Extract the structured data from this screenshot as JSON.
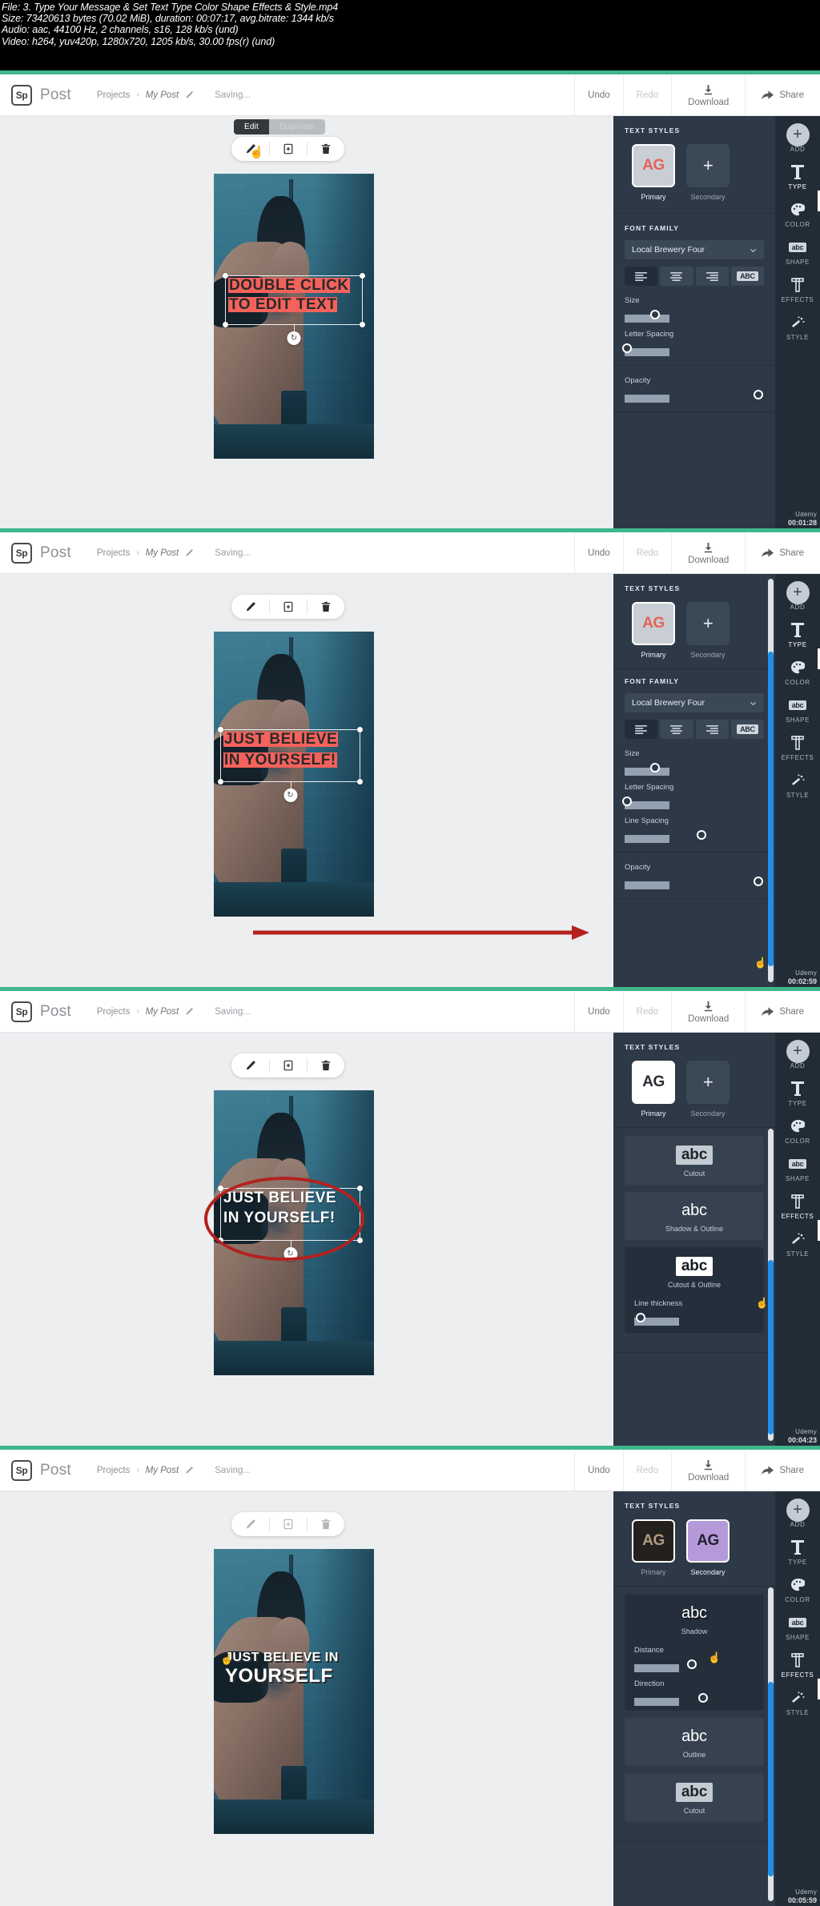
{
  "fileinfo": {
    "line1": "File: 3. Type Your Message & Set Text Type  Color  Shape  Effects & Style.mp4",
    "line2": "Size: 73420613 bytes (70.02 MiB), duration: 00:07:17, avg.bitrate: 1344 kb/s",
    "line3": "Audio: aac, 44100 Hz, 2 channels, s16, 128 kb/s (und)",
    "line4": "Video: h264, yuv420p, 1280x720, 1205 kb/s, 30.00 fps(r) (und)"
  },
  "appbar": {
    "logo": "Sp",
    "product": "Post",
    "crumb_root": "Projects",
    "crumb_sep": "›",
    "crumb_current": "My Post",
    "status": "Saving...",
    "undo": "Undo",
    "redo": "Redo",
    "download": "Download",
    "share": "Share"
  },
  "objtoolbar": {
    "tooltip_edit": "Edit",
    "tooltip_duplicate": "Duplicate"
  },
  "rail": {
    "items": [
      {
        "label": "ADD",
        "icon": "plus-circle-icon"
      },
      {
        "label": "TYPE",
        "icon": "type-t-icon"
      },
      {
        "label": "COLOR",
        "icon": "palette-icon"
      },
      {
        "label": "SHAPE",
        "icon": "abc-shape-icon"
      },
      {
        "label": "EFFECTS",
        "icon": "effects-t-icon"
      },
      {
        "label": "STYLE",
        "icon": "magic-wand-icon"
      }
    ]
  },
  "panels": [
    {
      "id": "panel-1",
      "timestamp": "00:01:28",
      "watermark": "Udemy",
      "canvas_text": [
        "DOUBLE CLICK",
        "TO EDIT TEXT"
      ],
      "canvas_text_style": "highlight",
      "active_rail": "TYPE",
      "sidebar": {
        "text_styles_title": "TEXT STYLES",
        "primary_label": "Primary",
        "secondary_label": "Secondary",
        "primary_glyph": "AG",
        "secondary_glyph": "+",
        "font_family_title": "FONT FAMILY",
        "font_family_value": "Local Brewery Four",
        "sliders": [
          {
            "label": "Size",
            "value": 22
          },
          {
            "label": "Letter Spacing",
            "value": 2
          },
          {
            "label": "Opacity",
            "value": 96
          }
        ]
      }
    },
    {
      "id": "panel-2",
      "timestamp": "00:02:59",
      "watermark": "Udemy",
      "canvas_text": [
        "JUST BELIEVE",
        "IN YOURSELF!"
      ],
      "canvas_text_style": "highlight",
      "active_rail": "TYPE",
      "sidebar": {
        "text_styles_title": "TEXT STYLES",
        "primary_label": "Primary",
        "secondary_label": "Secondary",
        "primary_glyph": "AG",
        "secondary_glyph": "+",
        "font_family_title": "FONT FAMILY",
        "font_family_value": "Local Brewery Four",
        "sliders": [
          {
            "label": "Size",
            "value": 22
          },
          {
            "label": "Letter Spacing",
            "value": 2
          },
          {
            "label": "Line Spacing",
            "value": 55
          },
          {
            "label": "Opacity",
            "value": 96
          }
        ]
      },
      "annotation": "red-arrow-to-opacity-slider"
    },
    {
      "id": "panel-3",
      "timestamp": "00:04:23",
      "watermark": "Udemy",
      "canvas_text": [
        "JUST BELIEVE",
        "IN YOURSELF!"
      ],
      "canvas_text_style": "cutout",
      "active_rail": "EFFECTS",
      "sidebar": {
        "text_styles_title": "TEXT STYLES",
        "primary_label": "Primary",
        "secondary_label": "Secondary",
        "primary_glyph": "AG",
        "secondary_glyph": "+",
        "effects": [
          {
            "name": "Cutout",
            "glyph": "abc"
          },
          {
            "name": "Shadow & Outline",
            "glyph": "abc"
          },
          {
            "name": "Cutout & Outline",
            "glyph": "abc"
          }
        ],
        "sliders": [
          {
            "label": "Line thickness",
            "value": 5
          }
        ]
      },
      "annotation": "red-ellipse-around-canvas-text"
    },
    {
      "id": "panel-4",
      "timestamp": "00:05:59",
      "watermark": "Udemy",
      "canvas_text": [
        "JUST BELIEVE IN",
        "YOURSELF"
      ],
      "canvas_text_style": "shadow",
      "active_rail": "EFFECTS",
      "sidebar": {
        "text_styles_title": "TEXT STYLES",
        "primary_label": "Primary",
        "secondary_label": "Secondary",
        "primary_glyph": "AG",
        "secondary_glyph": "AG",
        "effects": [
          {
            "name": "Shadow",
            "glyph": "abc"
          },
          {
            "name": "Outline",
            "glyph": "abc"
          },
          {
            "name": "Cutout",
            "glyph": "abc"
          }
        ],
        "sliders": [
          {
            "label": "Distance",
            "value": 48
          },
          {
            "label": "Direction",
            "value": 57
          }
        ]
      }
    }
  ],
  "colors": {
    "panel_bg": "#2d3946",
    "rail_bg": "#222c37",
    "accent_red": "#f4625c",
    "accent_purple": "#b49ad8",
    "annotation_red": "#b4211e",
    "separator_green": "#3fb68b",
    "scrollbar_blue": "#1e8fe8"
  }
}
